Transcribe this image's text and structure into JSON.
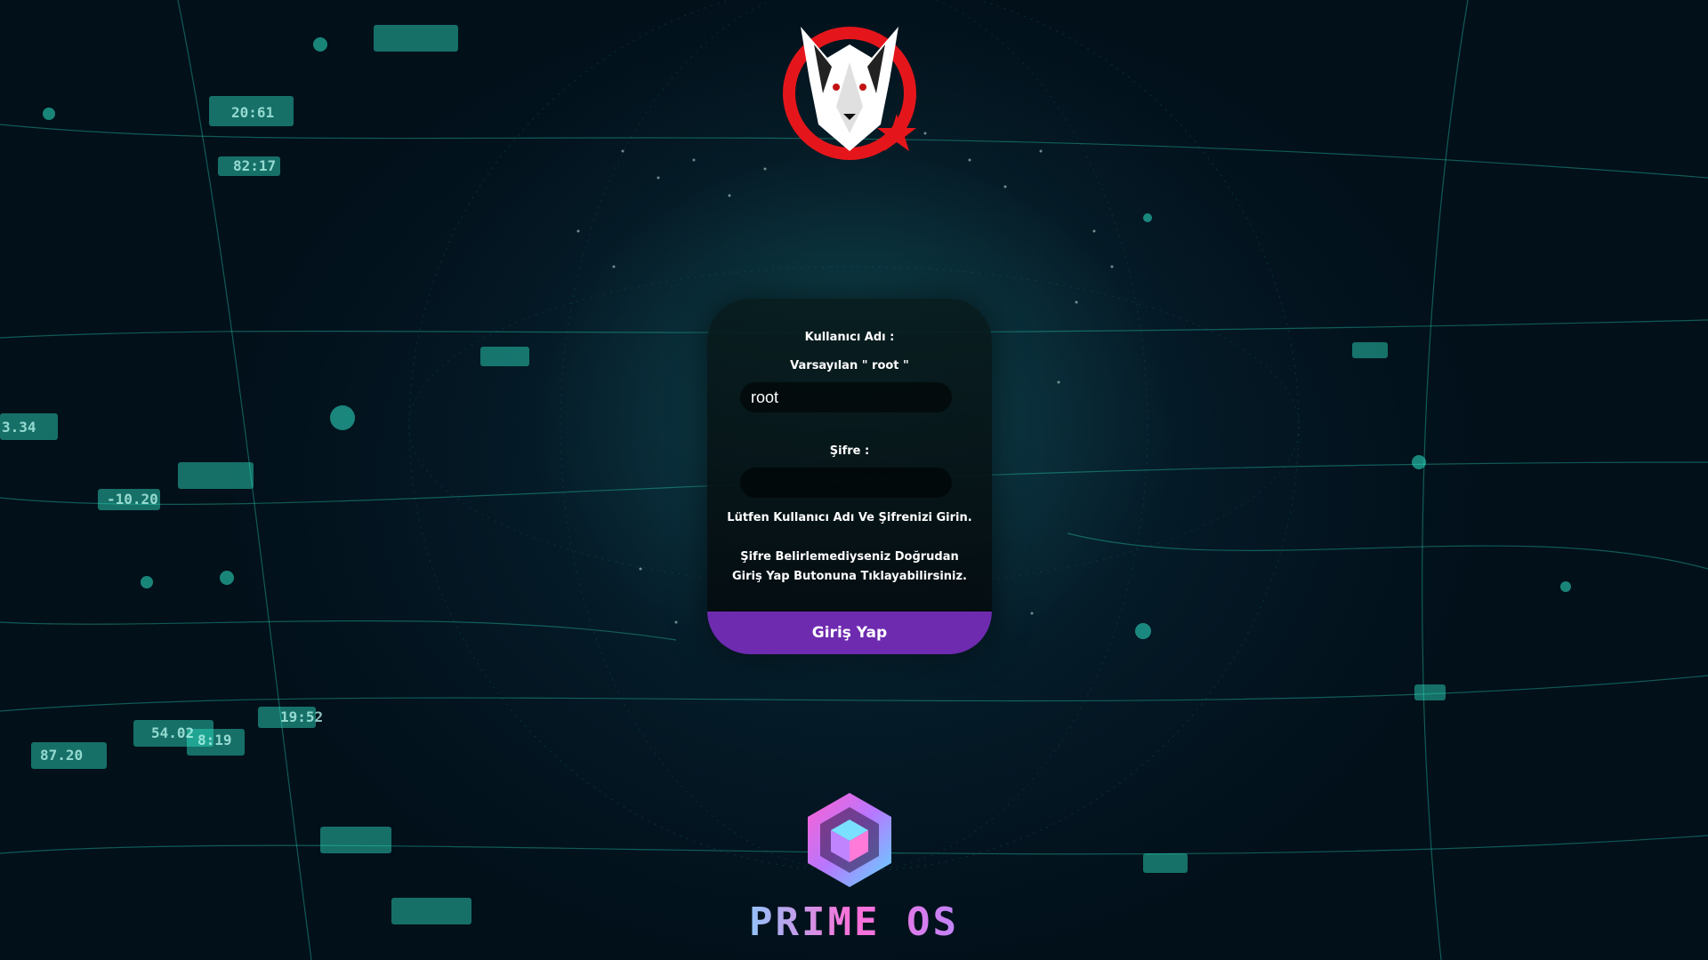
{
  "login": {
    "username_label": "Kullanıcı Adı :",
    "username_hint": "Varsayılan \" root \"",
    "username_value": "root",
    "password_label": "Şifre :",
    "password_value": "",
    "instruction": "Lütfen Kullanıcı Adı Ve Şifrenizi Girin.",
    "note": "Şifre Belirlemediyseniz Doğrudan Giriş Yap Butonuna Tıklayabilirsiniz.",
    "submit_label": "Giriş Yap"
  },
  "branding": {
    "product_name": "PRIME OS",
    "top_logo": "wolf-emblem-icon",
    "bottom_logo": "prime-os-cube-icon"
  },
  "background_readouts": [
    "20:61",
    "82:17",
    "3.34",
    "-10.20",
    "54.02",
    "8:19",
    "87.20",
    "19:52"
  ],
  "colors": {
    "accent_button": "#6e2bb0",
    "background": "#03131f",
    "grid_lines": "#2ee6c8"
  }
}
